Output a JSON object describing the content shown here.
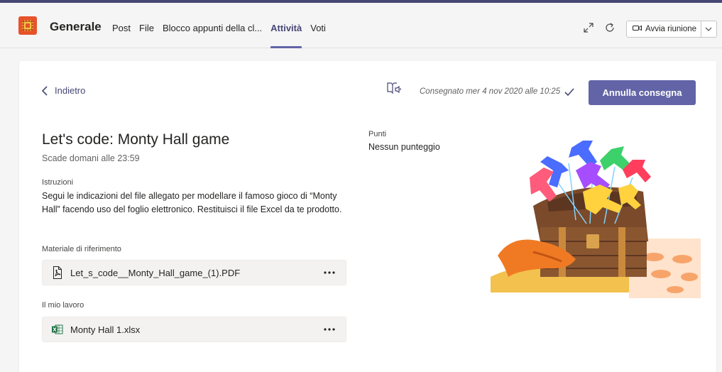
{
  "header": {
    "channel_name": "Generale",
    "tabs": [
      {
        "label": "Post"
      },
      {
        "label": "File"
      },
      {
        "label": "Blocco appunti della cl..."
      },
      {
        "label": "Attività",
        "active": true
      },
      {
        "label": "Voti"
      }
    ],
    "meet_button_label": "Avvia riunione",
    "accent_color": "#6264a7",
    "icons": [
      "expand-icon",
      "refresh-icon",
      "camera-icon",
      "chevron-down-icon"
    ]
  },
  "assignment": {
    "back_label": "Indietro",
    "status_text": "Consegnato mer 4 nov 2020 alle 10:25",
    "undo_button_label": "Annulla consegna",
    "title": "Let's code: Monty Hall game",
    "due": "Scade domani alle 23:59",
    "instructions_label": "Istruzioni",
    "instructions_text": "Segui le indicazioni del file allegato per modellare il famoso gioco di “Monty Hall” facendo uso del foglio elettronico. Restituisci il file Excel da te prodotto.",
    "reference_label": "Materiale di riferimento",
    "reference_file": "Let_s_code__Monty_Hall_game_(1).PDF",
    "my_work_label": "Il mio lavoro",
    "my_work_file": "Monty Hall 1.xlsx",
    "points_label": "Punti",
    "points_value": "Nessun punteggio"
  }
}
